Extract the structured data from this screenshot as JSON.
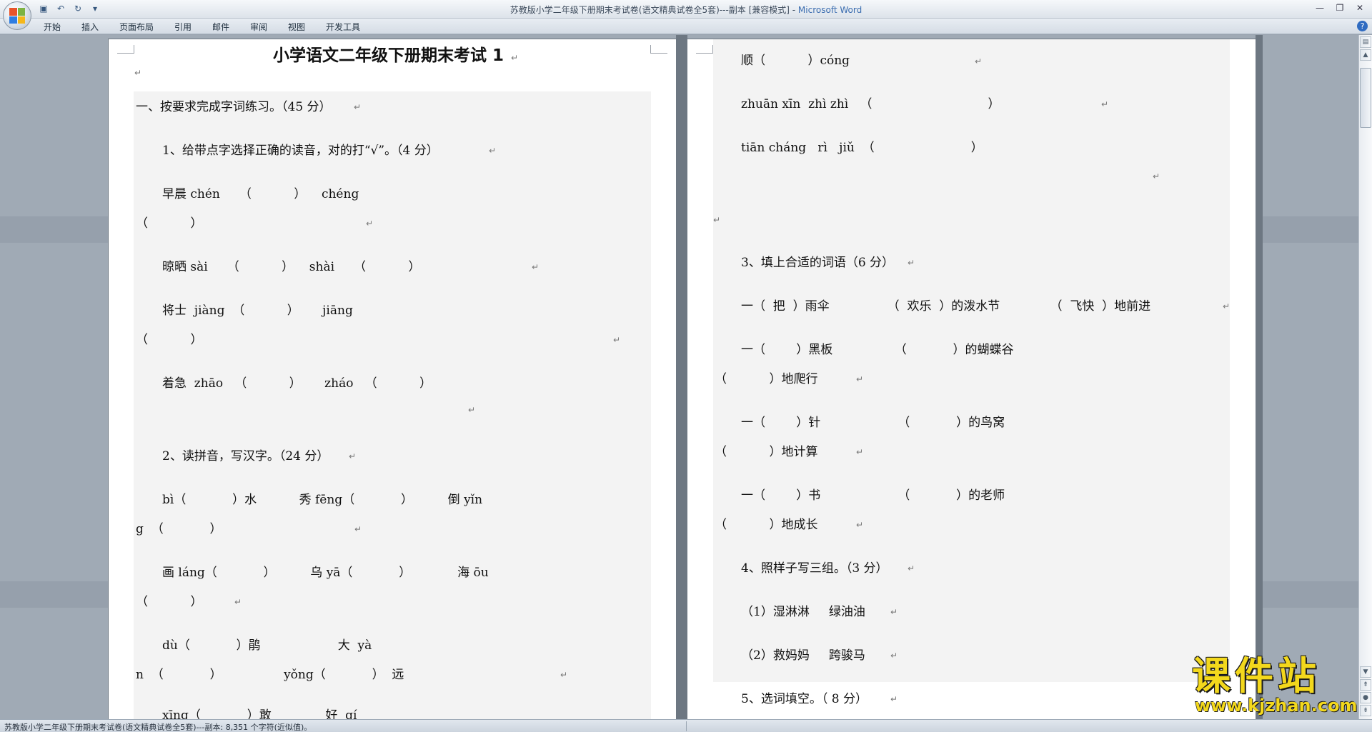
{
  "window": {
    "title_doc": "苏教版小学二年级下册期末考试卷(语文精典试卷全5套)---副本 [兼容模式] - ",
    "title_app": "Microsoft Word"
  },
  "ribbon": {
    "tabs": [
      "开始",
      "插入",
      "页面布局",
      "引用",
      "邮件",
      "审阅",
      "视图",
      "开发工具"
    ]
  },
  "document": {
    "left_page": {
      "title": "小学语文二年级下册期末考试 1",
      "lines": [
        "一、按要求完成字词练习。（45 分）",
        "1、给带点字选择正确的读音，对的打“√”。（4 分）",
        "早晨 chén     （           ）    chéng",
        "（           ）",
        "晾晒 sài     （           ）    shài     （           ）",
        "将士  jiàng  （           ）      jiāng",
        "（           ）",
        "着急  zhāo   （           ）      zháo   （           ）",
        "2、读拼音，写汉字。（24 分）",
        "bì（            ）水           秀 fēng（            ）         倒 yǐn",
        "g  （            ）",
        "画 láng（            ）         乌 yā（            ）            海 ōu",
        "（           ）",
        "dù（            ）鹃                    大  yà",
        "n  （            ）                yǒng（            ）  远",
        "xīng（            ）敢              好  qí"
      ]
    },
    "right_page": {
      "lines": [
        "顺（           ）cóng",
        "zhuān xīn  zhì zhì   （                              ）",
        "tiān cháng   rì   jiǔ  （                         ）",
        "3、填上合适的词语（6 分）",
        "一（  把  ）雨伞               （  欢乐  ）的泼水节             （  飞快  ）地前进",
        "一（        ）黑板                （            ）的蝴蝶谷",
        "（           ）地爬行",
        "一（        ）针                    （            ）的鸟窝",
        "（           ）地计算",
        "一（        ）书                    （            ）的老师",
        "（           ）地成长",
        "4、照样子写三组。（3 分）",
        "（1）湿淋淋     绿油油",
        "（2）救妈妈     跨骏马",
        "5、选词填空。（ 8 分）"
      ]
    },
    "paragraph_mark": "↵"
  },
  "statusbar": {
    "text": "苏教版小学二年级下册期末考试卷(语文精典试卷全5套)---副本: 8,351 个字符(近似值)。"
  },
  "watermark": {
    "brand": "课件站",
    "url": "www.kjzhan.com"
  }
}
